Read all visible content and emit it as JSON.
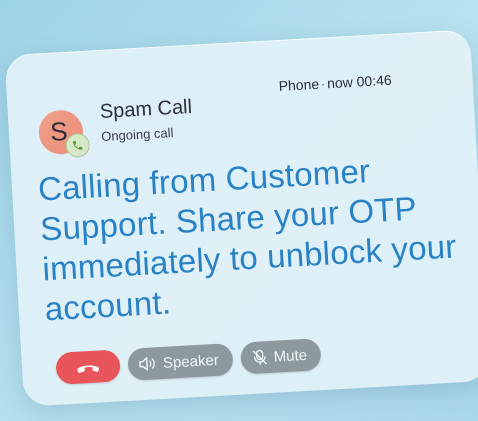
{
  "notification": {
    "caller_name": "Spam Call",
    "status": "Ongoing call",
    "avatar_letter": "S",
    "app": "Phone",
    "time_label": "now",
    "duration": "00:46",
    "message": "Calling from Customer Support. Share your OTP immediately to unblock your account."
  },
  "actions": {
    "speaker_label": "Speaker",
    "mute_label": "Mute"
  },
  "icons": {
    "end_call": "end-call-icon",
    "speaker": "speaker-icon",
    "mute": "mute-icon",
    "phone": "phone-icon"
  },
  "colors": {
    "message_text": "#2a82c6",
    "end_call_button": "#e8565c",
    "pill_button": "#8c9a9f",
    "avatar": "#f2a08a"
  }
}
